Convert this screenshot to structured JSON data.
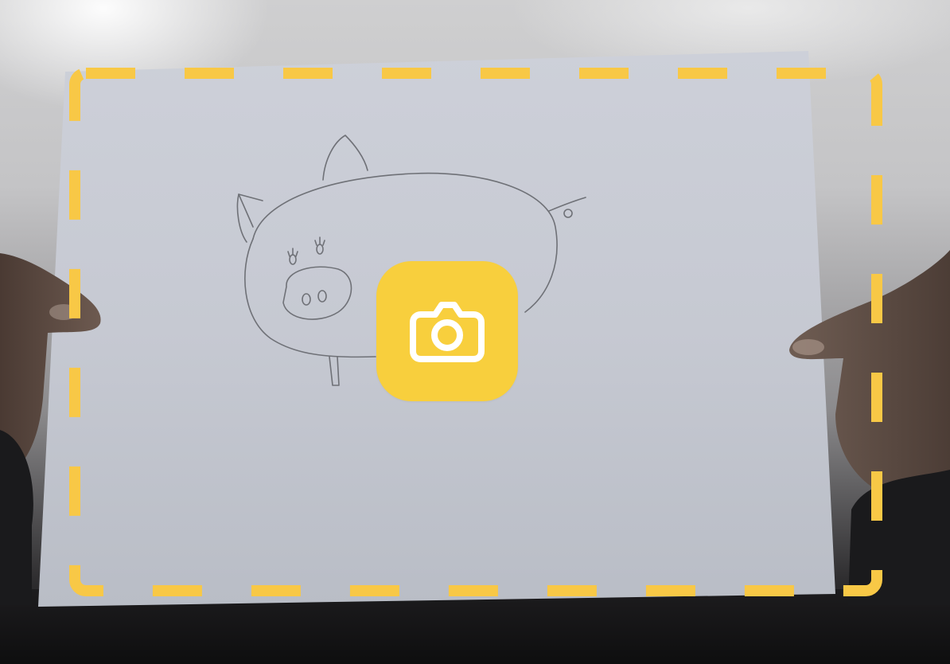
{
  "camera_view": {
    "subject": "pig-drawing",
    "frame_color": "#f8c846",
    "button_color": "#f8cf3d",
    "button_icon": "camera-icon",
    "button_icon_color": "#ffffff"
  }
}
